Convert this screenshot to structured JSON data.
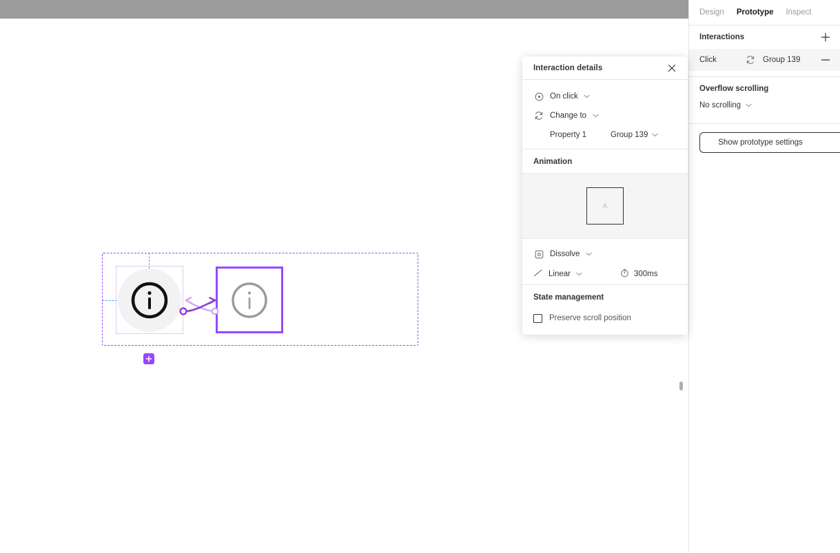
{
  "topbar": {
    "label": "toolbar-strip"
  },
  "canvas": {
    "component_set": {
      "name": "component-set-frame",
      "variants": [
        {
          "name": "variant-default",
          "icon": "info-circle-icon",
          "state": "unselected"
        },
        {
          "name": "variant-hover",
          "icon": "info-circle-icon",
          "state": "selected"
        }
      ],
      "add_variant_label": "+",
      "connectors": [
        {
          "name": "interaction-connector-forward",
          "direction": "right",
          "color": "#8b3dd4"
        },
        {
          "name": "interaction-connector-back",
          "direction": "left",
          "color": "#cda9ee"
        }
      ]
    },
    "guides": {
      "vertical": "alignment-guide-vertical",
      "horizontal": "alignment-guide-horizontal"
    }
  },
  "details_panel": {
    "title": "Interaction details",
    "close_label": "×",
    "trigger": {
      "icon": "click-target-icon",
      "label": "On click"
    },
    "action": {
      "icon": "change-to-icon",
      "label": "Change to"
    },
    "property": {
      "name": "Property 1",
      "value": "Group 139"
    },
    "animation": {
      "section_title": "Animation",
      "preview_label": "A",
      "type": {
        "icon": "dissolve-icon",
        "label": "Dissolve"
      },
      "easing": {
        "icon": "linear-curve-icon",
        "label": "Linear"
      },
      "duration": {
        "icon": "timer-icon",
        "value": "300ms"
      }
    },
    "state_management": {
      "section_title": "State management",
      "preserve_scroll_label": "Preserve scroll position",
      "preserve_scroll_checked": false
    }
  },
  "sidebar": {
    "tabs": [
      {
        "label": "Design",
        "active": false
      },
      {
        "label": "Prototype",
        "active": true
      },
      {
        "label": "Inspect",
        "active": false
      }
    ],
    "interactions": {
      "title": "Interactions",
      "add_label": "+",
      "rows": [
        {
          "trigger": "Click",
          "icon": "change-to-icon",
          "target": "Group 139",
          "remove_label": "−"
        }
      ]
    },
    "overflow_scrolling": {
      "title": "Overflow scrolling",
      "value": "No scrolling"
    },
    "prototype_settings_button": "Show prototype settings"
  },
  "colors": {
    "purple": "#9747ff",
    "purple_dark": "#8b3dd4",
    "purple_light": "#cda9ee",
    "guide_blue": "#4a9df5",
    "topbar_gray": "#9b9b9b",
    "row_highlight": "#f5f5f5"
  }
}
